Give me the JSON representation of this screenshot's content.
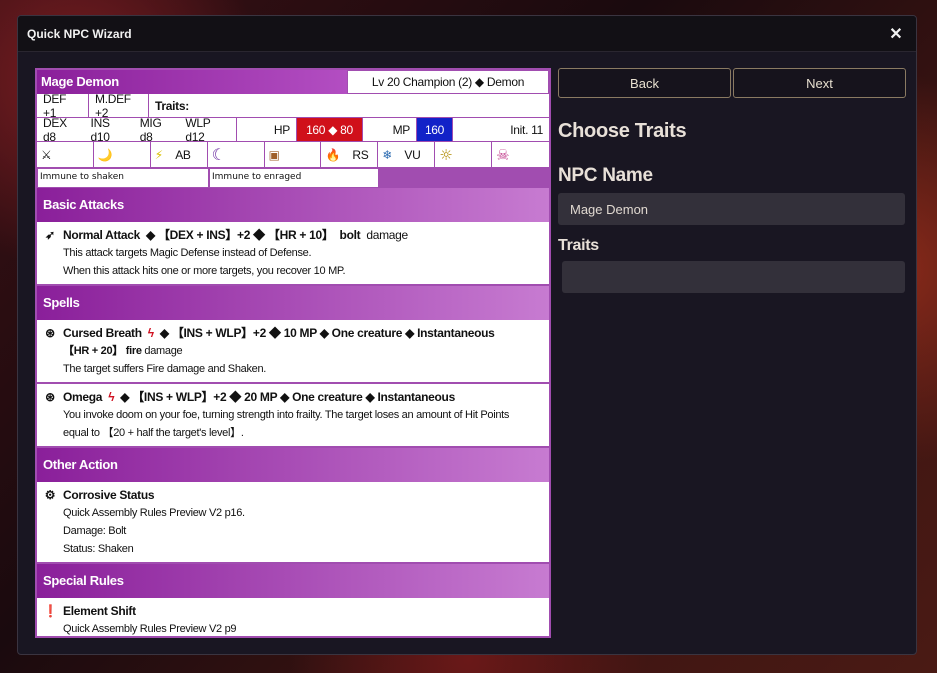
{
  "window": {
    "title": "Quick NPC Wizard",
    "close": "✕"
  },
  "npc": {
    "name": "Mage Demon",
    "level_line": "Lv 20 Champion (2) ◆ Demon",
    "def": "DEF +1",
    "mdef": "M.DEF +2",
    "traits_label": "Traits:",
    "attrs": [
      "DEX d8",
      "INS d10",
      "MIG d8",
      "WLP d12"
    ],
    "hp_label": "HP",
    "hp_value": "160 ◆ 80",
    "mp_label": "MP",
    "mp_value": "160",
    "init": "Init. 11",
    "affinities": [
      {
        "icon": "physical-icon",
        "glyph": "⚔",
        "value": ""
      },
      {
        "icon": "air-icon",
        "glyph": "🌙",
        "value": ""
      },
      {
        "icon": "bolt-icon",
        "glyph": "⚡",
        "value": "AB"
      },
      {
        "icon": "dark-icon",
        "glyph": "☾",
        "value": ""
      },
      {
        "icon": "earth-icon",
        "glyph": "▣",
        "value": ""
      },
      {
        "icon": "fire-icon",
        "glyph": "🔥",
        "value": "RS"
      },
      {
        "icon": "ice-icon",
        "glyph": "❄",
        "value": "VU"
      },
      {
        "icon": "light-icon",
        "glyph": "☼",
        "value": ""
      },
      {
        "icon": "poison-icon",
        "glyph": "☠",
        "value": ""
      }
    ],
    "immunities": [
      "Immune to shaken",
      "Immune to enraged"
    ]
  },
  "sections": {
    "basic": "Basic Attacks",
    "spells": "Spells",
    "other": "Other Action",
    "special": "Special Rules"
  },
  "basic_attack": {
    "name": "Normal Attack",
    "formula": "◆ 【DEX + INS】+2   ◆ 【HR + 10】",
    "dmg_type": "bolt",
    "dmg_word": "damage",
    "desc1": "This attack targets Magic Defense instead of Defense.",
    "desc2": "When this attack hits one or more targets, you recover 10 MP."
  },
  "spell1": {
    "name": "Cursed Breath",
    "line": "◆ 【INS + WLP】+2  ◆ 10 MP ◆ One creature ◆ Instantaneous",
    "dmg": "【HR + 20】",
    "dmg_type": "fire",
    "dmg_word": "damage",
    "desc": "The target suffers Fire damage and Shaken."
  },
  "spell2": {
    "name": "Omega",
    "line": "◆ 【INS + WLP】+2  ◆ 20 MP ◆ One creature ◆ Instantaneous",
    "desc1": "You invoke doom on your foe, turning strength into frailty. The target loses an amount of Hit Points",
    "desc2": "equal to 【20 + half the target's level】."
  },
  "other_action": {
    "name": "Corrosive Status",
    "desc1": "Quick Assembly Rules Preview V2 p16.",
    "desc2": "Damage: Bolt",
    "desc3": "Status: Shaken"
  },
  "special_rule": {
    "name": "Element Shift",
    "desc1": "Quick Assembly Rules Preview V2 p9"
  },
  "panel": {
    "back": "Back",
    "next": "Next",
    "heading": "Choose Traits",
    "name_label": "NPC Name",
    "name_value": "Mage Demon",
    "traits_label": "Traits",
    "traits_value": ""
  }
}
